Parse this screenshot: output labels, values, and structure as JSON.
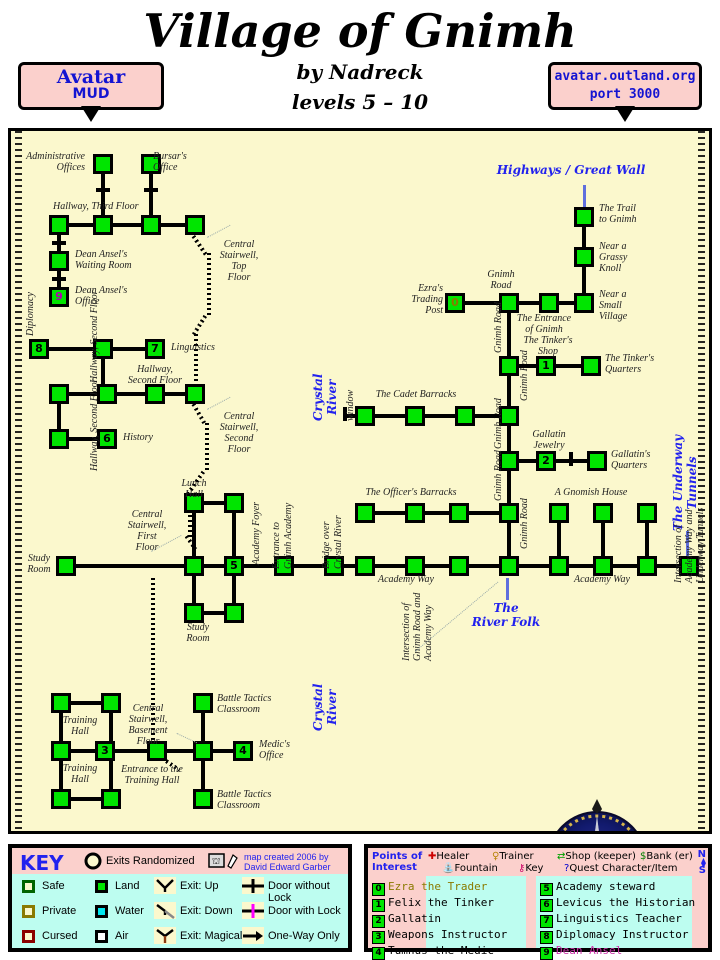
{
  "header": {
    "title": "Village of Gnimh",
    "byline": "by Nadreck",
    "levels": "levels 5 – 10",
    "banner_left_line1": "Avatar",
    "banner_left_line2": "MUD",
    "banner_right_line1": "avatar.outland.org",
    "banner_right_line2": "port 3000"
  },
  "map": {
    "region_labels": {
      "highways": "Highways / Great Wall",
      "crystal_river_top": "Crystal River",
      "crystal_river_bottom": "Crystal River",
      "underway_tunnels": "The Underway Tunnels",
      "river_folk": "The River Folk",
      "window": "window"
    },
    "rooms": [
      {
        "label": "Administrative Offices"
      },
      {
        "label": "Bursar's Office"
      },
      {
        "label": "Hallway, Third Floor"
      },
      {
        "label": "Dean Ansel's Waiting Room"
      },
      {
        "label": "Dean Ansel's Office",
        "num": "9"
      },
      {
        "label": "Central Stairwell, Top Floor"
      },
      {
        "label": "Diplomacy",
        "num": "8"
      },
      {
        "label": "Linguistics",
        "num": "7"
      },
      {
        "label": "Hallway, Second Floor"
      },
      {
        "label": "History",
        "num": "6"
      },
      {
        "label": "Central Stairwell, Second Floor"
      },
      {
        "label": "Lunch Hall"
      },
      {
        "label": "Central Stairwell, First Floor"
      },
      {
        "label": "Study Room"
      },
      {
        "label": "Study Room"
      },
      {
        "label": "Academy Foyer",
        "num": "5"
      },
      {
        "label": "Entrance to Gnimh Academy"
      },
      {
        "label": "Bridge over Crystal River"
      },
      {
        "label": "Central Stairwell, Basement Floor"
      },
      {
        "label": "Training Hall"
      },
      {
        "label": "Training Hall"
      },
      {
        "label": "Entrance to the Training Hall",
        "num": "3"
      },
      {
        "label": "Battle Tactics Classroom"
      },
      {
        "label": "Battle Tactics Classroom"
      },
      {
        "label": "Medic's Office",
        "num": "4"
      },
      {
        "label": "The Trail to Gnimh"
      },
      {
        "label": "Near a Grassy Knoll"
      },
      {
        "label": "Near a Small Village"
      },
      {
        "label": "Ezra's Trading Post",
        "num": "0"
      },
      {
        "label": "Gnimh Road"
      },
      {
        "label": "The Entrance of Gnimh"
      },
      {
        "label": "The Tinker's Shop",
        "num": "1"
      },
      {
        "label": "The Tinker's Quarters"
      },
      {
        "label": "The Cadet Barracks"
      },
      {
        "label": "Gallatin Jewelry",
        "num": "2"
      },
      {
        "label": "Gallatin's Quarters"
      },
      {
        "label": "The Officer's Barracks"
      },
      {
        "label": "A Gnomish House"
      },
      {
        "label": "Academy Way"
      },
      {
        "label": "Intersection of Gnimh Road and Academy Way"
      },
      {
        "label": "Intersection of Academy Way and Underway Tunnels"
      }
    ],
    "text": {
      "administrative_offices": "Administrative\nOffices",
      "bursars_office": "Bursar's\nOffice",
      "hallway_third": "Hallway, Third Floor",
      "dean_waiting": "Dean Ansel's\nWaiting Room",
      "dean_office": "Dean Ansel's\nOffice",
      "central_top": "Central\nStairwell,\nTop\nFloor",
      "diplomacy": "Diplomacy",
      "linguistics": "Linguistics",
      "hallway_second_h": "Hallway,\nSecond Floor",
      "hallway_second_v1": "Hallway, Second Floor",
      "hallway_second_v2": "Hallway, Second Floor",
      "history": "History",
      "central_second": "Central\nStairwell,\nSecond\nFloor",
      "lunch_hall": "Lunch\nHall",
      "central_first": "Central\nStairwell,\nFirst\nFloor",
      "study_room_left": "Study\nRoom",
      "study_room_bottom": "Study\nRoom",
      "academy_foyer": "Academy Foyer",
      "entrance_academy": "Entrance to\nGnimh Academy",
      "bridge": "Bridge over\nCrystal River",
      "central_basement": "Central\nStairwell,\nBasement\nFloor",
      "training_hall_1": "Training\nHall",
      "training_hall_2": "Training\nHall",
      "entrance_training": "Entrance to the\nTraining Hall",
      "battle_tactics_1": "Battle Tactics\nClassroom",
      "battle_tactics_2": "Battle Tactics\nClassroom",
      "medics_office": "Medic's\nOffice",
      "trail_to_gnimh": "The Trail\nto Gnimh",
      "grassy_knoll": "Near a\nGrassy\nKnoll",
      "small_village": "Near a\nSmall\nVillage",
      "ezras": "Ezra's\nTrading\nPost",
      "gnimh_road_top": "Gnimh\nRoad",
      "entrance_gnimh": "The Entrance\nof Gnimh",
      "gnimh_road_v1": "Gnimh Road",
      "gnimh_road_v2": "Gnimh Road",
      "gnimh_road_v3": "Gnimh Road",
      "gnimh_road_v4": "Gnimh Road",
      "gnimh_road_v5": "Gnimh Road",
      "tinkers_shop": "The Tinker's\nShop",
      "tinkers_quarters": "The Tinker's\nQuarters",
      "cadet_barracks": "The Cadet Barracks",
      "gallatin_jewelry": "Gallatin\nJewelry",
      "gallatins_quarters": "Gallatin's\nQuarters",
      "officers_barracks": "The Officer's Barracks",
      "gnomish_house": "A Gnomish House",
      "academy_way_left": "Academy Way",
      "academy_way_right": "Academy Way",
      "intersection_gnimh": "Intersection of\nGnimh Road and\nAcademy Way",
      "intersection_underway": "Intersection of\nAcademy Way and\nUnderway Tunnels"
    }
  },
  "key": {
    "title": "KEY",
    "exits_randomized": "Exits Randomized",
    "credit": "map created 2006 by\nDavid Edward Garber",
    "items": [
      {
        "label": "Safe",
        "icon": "safe-swatch"
      },
      {
        "label": "Private",
        "icon": "private-swatch"
      },
      {
        "label": "Cursed",
        "icon": "cursed-swatch"
      },
      {
        "label": "Land",
        "icon": "land-swatch"
      },
      {
        "label": "Water",
        "icon": "water-swatch"
      },
      {
        "label": "Air",
        "icon": "air-swatch"
      },
      {
        "label": "Exit: Up",
        "icon": "exit-up-icon"
      },
      {
        "label": "Exit: Down",
        "icon": "exit-down-icon"
      },
      {
        "label": "Exit: Magical",
        "icon": "exit-magical-icon"
      },
      {
        "label": "Door without Lock",
        "icon": "door-nolock-icon"
      },
      {
        "label": "Door with Lock",
        "icon": "door-lock-icon"
      },
      {
        "label": "One-Way Only",
        "icon": "one-way-icon"
      }
    ]
  },
  "poi": {
    "title": "Points of\nInterest",
    "symbols": [
      {
        "glyph": "✚",
        "label": "Healer",
        "color": "#cc0000"
      },
      {
        "glyph": "♀",
        "label": "Trainer",
        "color": "#b8860b"
      },
      {
        "glyph": "⇄",
        "label": "Shop (keeper)",
        "color": "#00a000"
      },
      {
        "glyph": "$",
        "label": "Bank (er)",
        "color": "#008000"
      },
      {
        "glyph": "⛲",
        "label": "Fountain",
        "color": "#0000cc"
      },
      {
        "glyph": "⚷",
        "label": "Key",
        "color": "#cc0066"
      },
      {
        "glyph": "?",
        "label": "Quest Character/Item",
        "color": "#0000cc"
      }
    ],
    "left_entries": [
      {
        "num": "0",
        "label": "Ezra the Trader",
        "color": "#8a7a00"
      },
      {
        "num": "1",
        "label": "Felix the Tinker",
        "color": "#000000"
      },
      {
        "num": "2",
        "label": "Gallatin",
        "color": "#000000"
      },
      {
        "num": "3",
        "label": "Weapons Instructor",
        "color": "#000000"
      },
      {
        "num": "4",
        "label": "Tumnus the Medic",
        "color": "#000000"
      }
    ],
    "right_entries": [
      {
        "num": "5",
        "label": "Academy steward",
        "color": "#000000"
      },
      {
        "num": "6",
        "label": "Levicus the Historian",
        "color": "#000000"
      },
      {
        "num": "7",
        "label": "Linguistics Teacher",
        "color": "#000000"
      },
      {
        "num": "8",
        "label": "Diplomacy Instructor",
        "color": "#000000"
      },
      {
        "num": "9",
        "label": "Dean Ansel",
        "color": "#cc33aa"
      }
    ],
    "compass_n": "N",
    "compass_s": "S"
  }
}
